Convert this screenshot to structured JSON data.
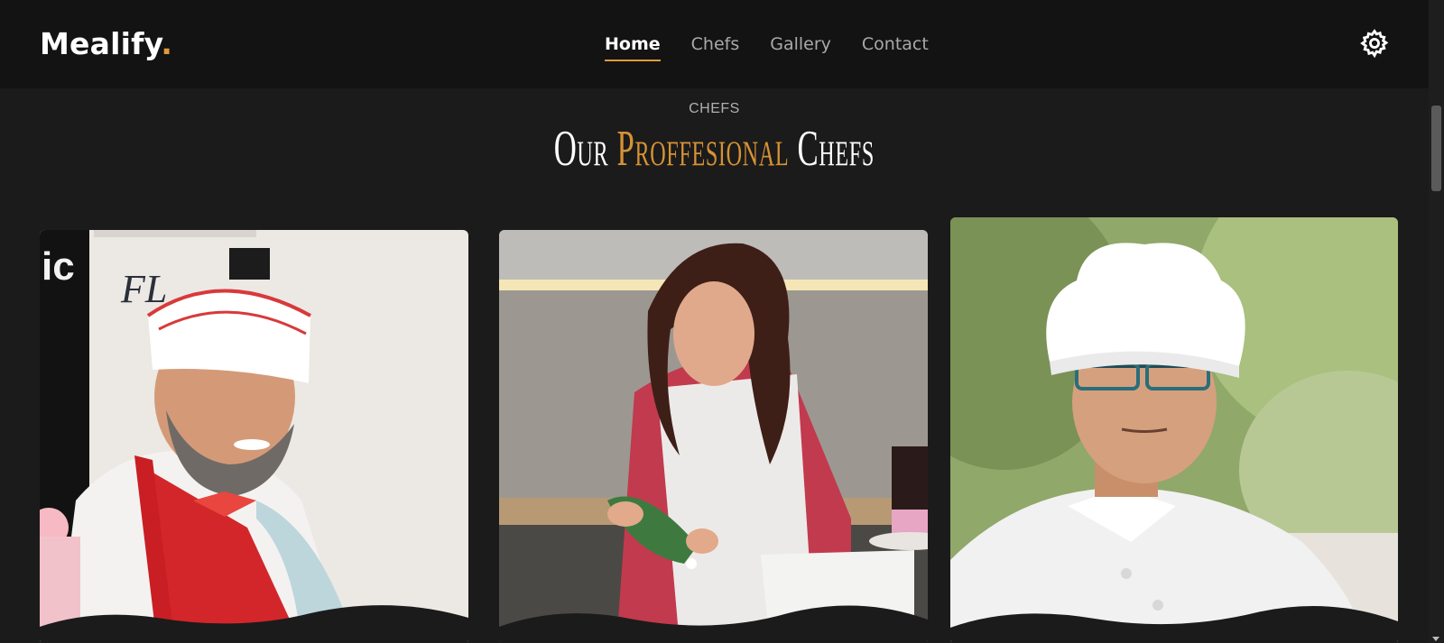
{
  "brand": {
    "name": "Mealify",
    "dot": "."
  },
  "nav": {
    "items": [
      {
        "label": "Home",
        "active": true
      },
      {
        "label": "Chefs",
        "active": false
      },
      {
        "label": "Gallery",
        "active": false
      },
      {
        "label": "Contact",
        "active": false
      }
    ],
    "settings_icon": "gear-icon"
  },
  "section": {
    "eyebrow": "CHEFS",
    "title_pre": "Our ",
    "title_accent": "Proffesional",
    "title_post": " Chefs"
  },
  "chefs": [
    {
      "photo": "bearded chef in paper hat and red apron"
    },
    {
      "photo": "female chef with piping bag"
    },
    {
      "photo": "chef with toque and glasses"
    }
  ],
  "colors": {
    "accent": "#e2993a",
    "header_bg": "#131313",
    "page_bg": "#1b1b1b"
  }
}
